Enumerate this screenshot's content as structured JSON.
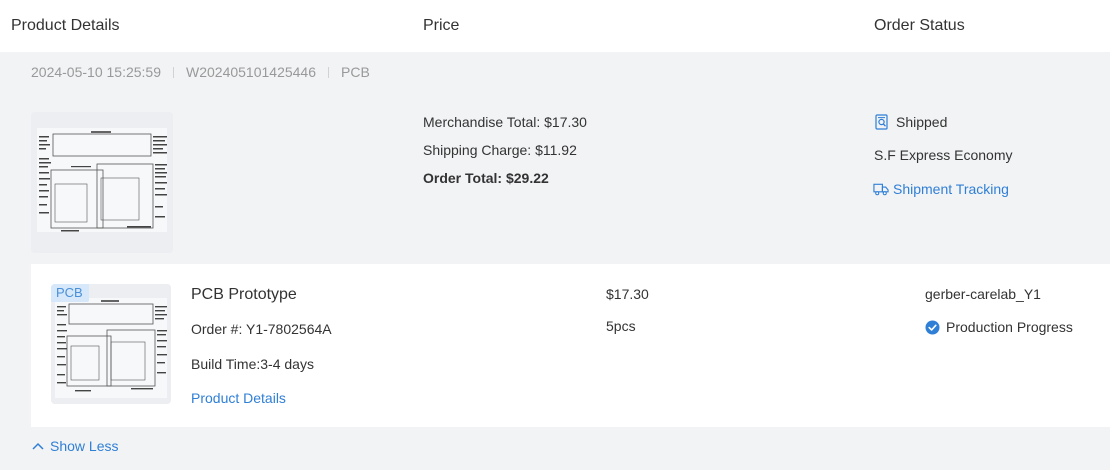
{
  "header": {
    "col_product": "Product Details",
    "col_price": "Price",
    "col_status": "Order Status"
  },
  "order": {
    "date": "2024-05-10 15:25:59",
    "number": "W202405101425446",
    "type": "PCB",
    "merchandise_total": "Merchandise Total: $17.30",
    "shipping_charge": "Shipping Charge: $11.92",
    "order_total": "Order Total: $29.22",
    "status": "Shipped",
    "carrier": "S.F Express Economy",
    "tracking_label": "Shipment Tracking"
  },
  "item": {
    "badge": "PCB",
    "title": "PCB Prototype",
    "order_no": "Order #: Y1-7802564A",
    "build_time": "Build Time:3-4 days",
    "details_link": "Product Details",
    "price": "$17.30",
    "quantity": "5pcs",
    "file_name": "gerber-carelab_Y1",
    "progress_label": "Production Progress"
  },
  "footer": {
    "show_less": "Show Less"
  },
  "colors": {
    "link": "#2f7fd6",
    "panel_bg": "#f2f3f5",
    "meta_text": "#999999",
    "badge_bg": "#d6e8fa"
  },
  "icons": {
    "status": "magnifier-document-icon",
    "tracking": "truck-icon",
    "progress": "check-circle-icon",
    "collapse": "chevron-up-icon"
  }
}
